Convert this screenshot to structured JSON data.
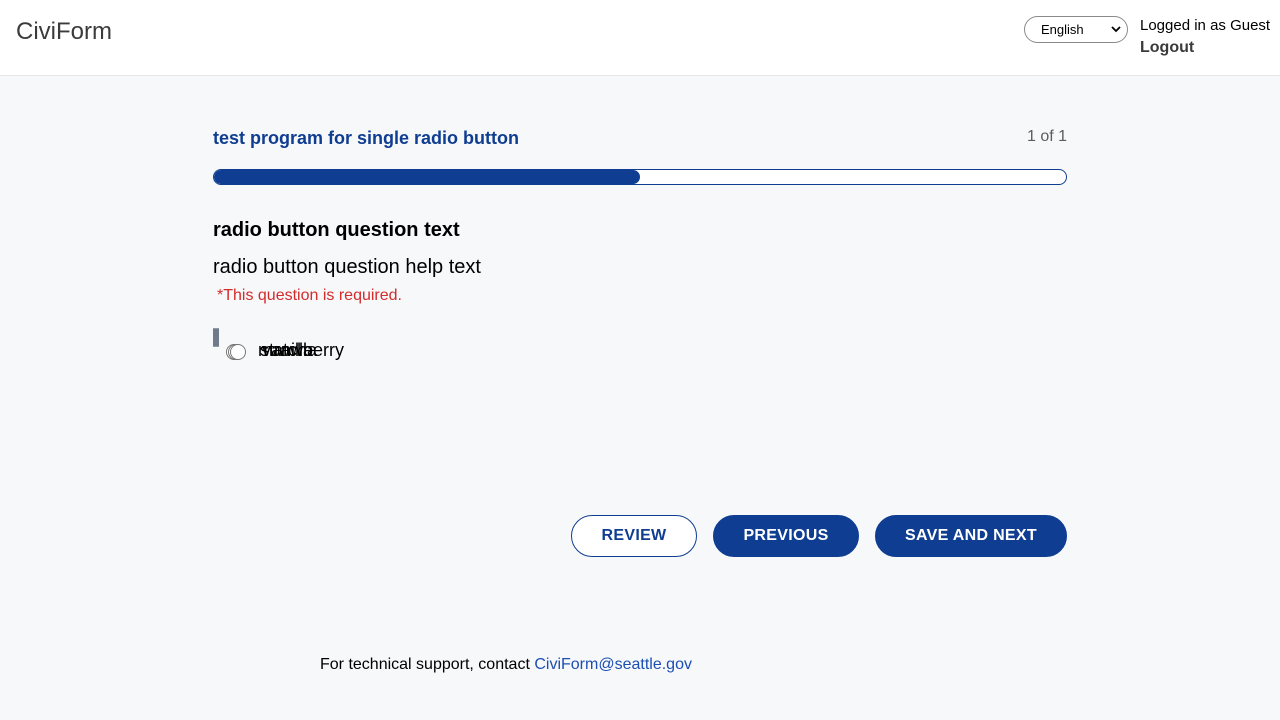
{
  "header": {
    "brand": "CiviForm",
    "language_selected": "English",
    "user_label": "Logged in as Guest",
    "logout_label": "Logout"
  },
  "program": {
    "title": "test program for single radio button",
    "block_counter": "1 of 1",
    "progress_fraction": 0.5
  },
  "question": {
    "text": "radio button question text",
    "help_text": "radio button question help text",
    "required_text": "*This question is required.",
    "options": [
      {
        "label": "matcha",
        "checked": false
      },
      {
        "label": "strawberry",
        "checked": false
      },
      {
        "label": "vanilla",
        "checked": false
      }
    ]
  },
  "actions": {
    "review_label": "REVIEW",
    "previous_label": "PREVIOUS",
    "save_next_label": "SAVE AND NEXT"
  },
  "footer": {
    "support_text": "For technical support, contact",
    "support_email": "CiviForm@seattle.gov"
  },
  "colors": {
    "primary": "#0f3d91",
    "error": "#d42b2b",
    "background": "#f7f8fa"
  }
}
